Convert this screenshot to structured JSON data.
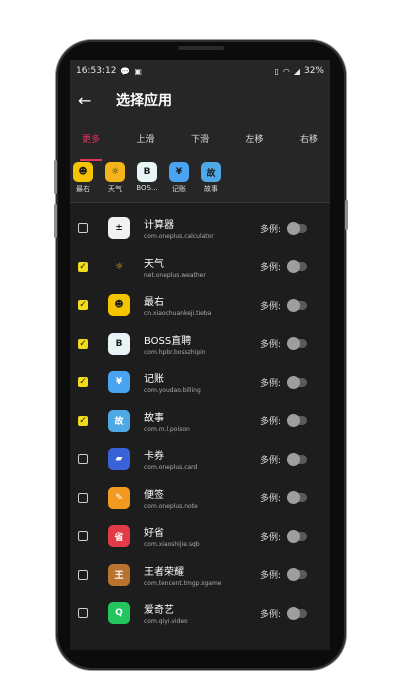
{
  "status_bar": {
    "time": "16:53:12",
    "battery": "32%"
  },
  "app_bar": {
    "back_icon": "arrow-left-icon",
    "title": "选择应用"
  },
  "tabs": [
    {
      "label": "更多",
      "active": true
    },
    {
      "label": "上滑",
      "active": false
    },
    {
      "label": "下滑",
      "active": false
    },
    {
      "label": "左移",
      "active": false
    },
    {
      "label": "右移",
      "active": false
    }
  ],
  "selected_apps": [
    {
      "label": "最右",
      "icon": "zuiyou-icon",
      "color": "#f5c400",
      "glyph": "☻"
    },
    {
      "label": "天气",
      "icon": "weather-icon",
      "color": "#f3b51a",
      "glyph": "☼"
    },
    {
      "label": "BOS...",
      "icon": "boss-icon",
      "color": "#e8f4f6",
      "glyph": "B"
    },
    {
      "label": "记账",
      "icon": "billing-icon",
      "color": "#4aa3f0",
      "glyph": "¥"
    },
    {
      "label": "故事",
      "icon": "story-icon",
      "color": "#4ea8e6",
      "glyph": "故"
    }
  ],
  "multi_label": "多例:",
  "apps": [
    {
      "name": "计算器",
      "pkg": "com.oneplus.calculator",
      "checked": false,
      "icon": "calculator-icon",
      "color": "#f1f1f1",
      "glyph": "±"
    },
    {
      "name": "天气",
      "pkg": "net.oneplus.weather",
      "checked": true,
      "icon": "weather-icon",
      "color": "#1d1d1d",
      "glyph": "☼"
    },
    {
      "name": "最右",
      "pkg": "cn.xiaochuankeji.tieba",
      "checked": true,
      "icon": "zuiyou-icon",
      "color": "#f5c400",
      "glyph": "☻"
    },
    {
      "name": "BOSS直聘",
      "pkg": "com.hpbr.bosszhipin",
      "checked": true,
      "icon": "boss-icon",
      "color": "#e8f4f6",
      "glyph": "B"
    },
    {
      "name": "记账",
      "pkg": "com.youdao.billing",
      "checked": true,
      "icon": "billing-icon",
      "color": "#4aa3f0",
      "glyph": "¥"
    },
    {
      "name": "故事",
      "pkg": "com.m.l.poison",
      "checked": true,
      "icon": "story-icon",
      "color": "#4ea8e6",
      "glyph": "故"
    },
    {
      "name": "卡券",
      "pkg": "com.oneplus.card",
      "checked": false,
      "icon": "card-icon",
      "color": "#3a62d8",
      "glyph": "▰"
    },
    {
      "name": "便签",
      "pkg": "com.oneplus.note",
      "checked": false,
      "icon": "note-icon",
      "color": "#f29a1f",
      "glyph": "✎"
    },
    {
      "name": "好省",
      "pkg": "com.xiaoshijie.sqb",
      "checked": false,
      "icon": "haosheng-icon",
      "color": "#e23b47",
      "glyph": "省"
    },
    {
      "name": "王者荣耀",
      "pkg": "com.tencent.tmgp.sgame",
      "checked": false,
      "icon": "honor-of-kings-icon",
      "color": "#b9732f",
      "glyph": "王"
    },
    {
      "name": "爱奇艺",
      "pkg": "com.qiyi.video",
      "checked": false,
      "icon": "iqiyi-icon",
      "color": "#22c55e",
      "glyph": "Q"
    }
  ]
}
